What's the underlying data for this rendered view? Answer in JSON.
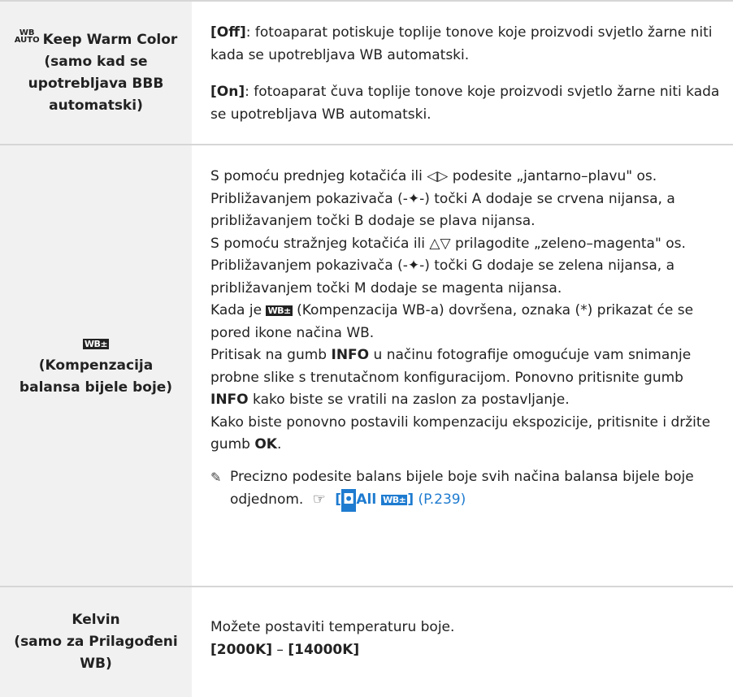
{
  "rows": [
    {
      "left_icon": "WB AUTO",
      "left_title": "Keep Warm Color",
      "left_subtitle_lines": [
        "(samo kad se",
        "upotrebljava BBB",
        "automatski)"
      ],
      "paras": [
        {
          "bold": "[Off]",
          "text": ": fotoaparat potiskuje toplije tonove koje proizvodi svjetlo žarne niti kada se upotrebljava WB automatski."
        },
        {
          "bold": "[On]",
          "text": ": fotoaparat čuva toplije tonove koje proizvodi svjetlo žarne niti kada se upotrebljava WB automatski."
        }
      ]
    },
    {
      "left_icon": "WB±",
      "left_lines": [
        "(Kompenzacija",
        "balansa bijele boje)"
      ],
      "line1": "S pomoću prednjeg kotačića ili ◁▷ podesite „jantarno–plavu\" os.",
      "line2": "Približavanjem pokazivača (-✦-) točki A dodaje se crvena nijansa, a približavanjem točki B dodaje se plava nijansa.",
      "line3": "S pomoću stražnjeg kotačića ili △▽ prilagodite „zeleno–magenta\" os. Približavanjem pokazivača (-✦-) točki G dodaje se zelena nijansa, a približavanjem točki M dodaje se magenta nijansa.",
      "line4_pre": "Kada je",
      "line4_post": "(Kompenzacija WB-a) dovršena, oznaka (*) prikazat će se pored ikone načina WB.",
      "line5_a": "Pritisak na gumb",
      "line5_b": "INFO",
      "line5_c": "u načinu fotografije omogućuje vam snimanje probne slike s trenutačnom konfiguracijom. Ponovno pritisnite gumb",
      "line5_d": "INFO",
      "line5_e": "kako biste se vratili na zaslon za postavljanje.",
      "line6_a": "Kako biste ponovno postavili kompenzaciju ekspozicije, pritisnite i držite gumb",
      "line6_b": "OK",
      "line6_c": ".",
      "tip_text": "Precizno podesite balans bijele boje svih načina balansa bijele boje odjednom.",
      "tip_ref_open": "[",
      "tip_ref_all": "All",
      "tip_ref_close": "]",
      "tip_page": "(P.239)",
      "wbz_label": "WB±"
    },
    {
      "left_lines": [
        "Kelvin",
        "(samo za Prilagođeni",
        "WB)"
      ],
      "desc": "Možete postaviti temperaturu boje.",
      "range_a": "[2000K]",
      "range_dash": " – ",
      "range_b": "[14000K]"
    }
  ],
  "icons": {
    "tip": "hint-hand-icon",
    "ref": "reference-hand-icon",
    "camera": "camera-icon"
  },
  "colors": {
    "accent": "#1e7bd0",
    "left_bg": "#f1f1f1",
    "border": "#d6d6d6"
  }
}
